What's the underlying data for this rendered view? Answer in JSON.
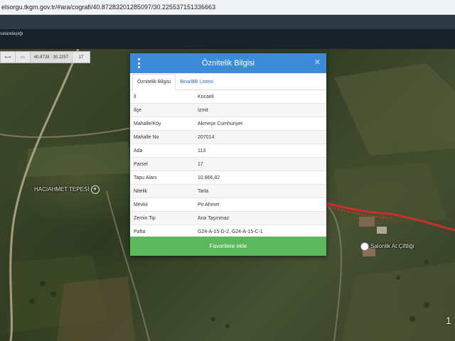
{
  "browser": {
    "url": "elsorgu.tkgm.gov.tr/#ara/cografi/40.87283201285097/30.225537151336663"
  },
  "site": {
    "subtitle_line1": "vatandaşlığı",
    "subtitle_line2": ""
  },
  "map_toolbar": {
    "expand_icon": "arrows-horizontal-icon",
    "print_icon": "printer-icon",
    "coordinates": "40.8728 : 30.2257",
    "zoom_level": "17"
  },
  "map": {
    "poi1": "HACIAHMET TEPESİ",
    "poi2": "Salonlik At Çiftliği",
    "corner_number": "1"
  },
  "modal": {
    "title": "Öznitelik Bilgisi",
    "menu_icon": "kebab-menu-icon",
    "close_icon": "close-icon",
    "tabs": [
      {
        "label": "Öznitelik Bilgisi",
        "active": true
      },
      {
        "label": "Bina/BB Listesi",
        "active": false
      }
    ],
    "rows": [
      {
        "key": "İl",
        "value": "Kocaeli"
      },
      {
        "key": "İlçe",
        "value": "İzmit"
      },
      {
        "key": "Mahalle/Köy",
        "value": "Akmeşe Cumhuriyet"
      },
      {
        "key": "Mahalle No",
        "value": "207014"
      },
      {
        "key": "Ada",
        "value": "113"
      },
      {
        "key": "Parsel",
        "value": "17"
      },
      {
        "key": "Tapu Alanı",
        "value": "10.866,82"
      },
      {
        "key": "Nitelik",
        "value": "Tarla"
      },
      {
        "key": "Mevkii",
        "value": "Pir Ahmet"
      },
      {
        "key": "Zemin Tip",
        "value": "Ana Taşınmaz"
      },
      {
        "key": "Pafta",
        "value": "G24-A-15-D-2, G24-A-15-C-1"
      }
    ],
    "favorite_button": "Favorilere ekle",
    "colors": {
      "header": "#3b8bd8",
      "favorite": "#5cb85c"
    }
  }
}
